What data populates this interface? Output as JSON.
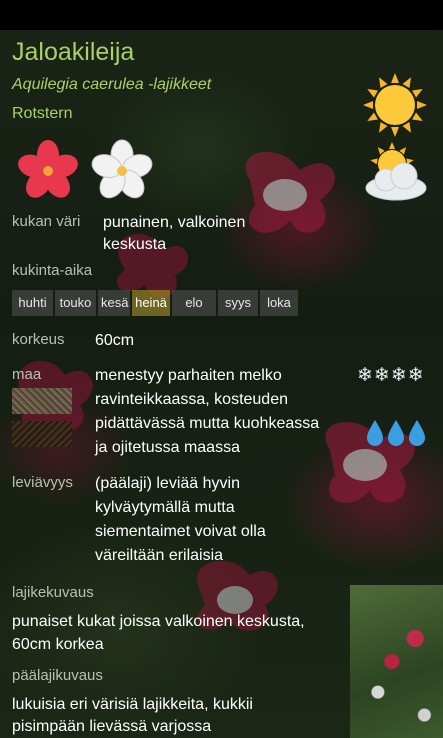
{
  "plant": {
    "name": "Jaloakileija",
    "latin": "Aquilegia caerulea -lajikkeet",
    "cultivar": "Rotstern"
  },
  "flower_color": {
    "label": "kukan väri",
    "value_line1": "punainen, valkoinen",
    "value_line2": "keskusta"
  },
  "bloom": {
    "label": "kukinta-aika",
    "months": [
      {
        "name": "huhti",
        "active": false
      },
      {
        "name": "touko",
        "active": false
      },
      {
        "name": "kesä",
        "active": false
      },
      {
        "name": "heinä",
        "active": true
      },
      {
        "name": "elo",
        "active": false
      },
      {
        "name": "syys",
        "active": false
      },
      {
        "name": "loka",
        "active": false
      }
    ]
  },
  "height": {
    "label": "korkeus",
    "value": "60cm"
  },
  "soil": {
    "label": "maa",
    "lines": [
      "menestyy parhaiten melko",
      "ravinteikkaassa, kosteuden",
      "pidättävässä mutta kuohkeassa",
      "ja ojitetussa maassa"
    ],
    "hardiness": "❄❄❄❄"
  },
  "spread": {
    "label": "leviävyys",
    "lines": [
      "(päälaji) leviää hyvin",
      "kylväytymällä mutta",
      "siementaimet voivat olla",
      "väreiltään erilaisia"
    ]
  },
  "cultivar_desc": {
    "label": "lajikekuvaus",
    "lines": [
      "punaiset kukat joissa valkoinen keskusta,",
      "60cm korkea"
    ]
  },
  "species_desc": {
    "label": "päälajikuvaus",
    "lines": [
      "lukuisia eri värisiä lajikkeita, kukkii",
      "pisimpään lievässä varjossa"
    ]
  },
  "icons": {
    "sun": "sun-icon",
    "partial_sun": "sun-cloud-icon",
    "flower_red": "red-flower-icon",
    "flower_white": "white-flower-icon",
    "water": "water-drops-icon"
  },
  "colors": {
    "accent": "#a8d267",
    "label": "#b8c0b0",
    "active_month": "#a08c28"
  }
}
